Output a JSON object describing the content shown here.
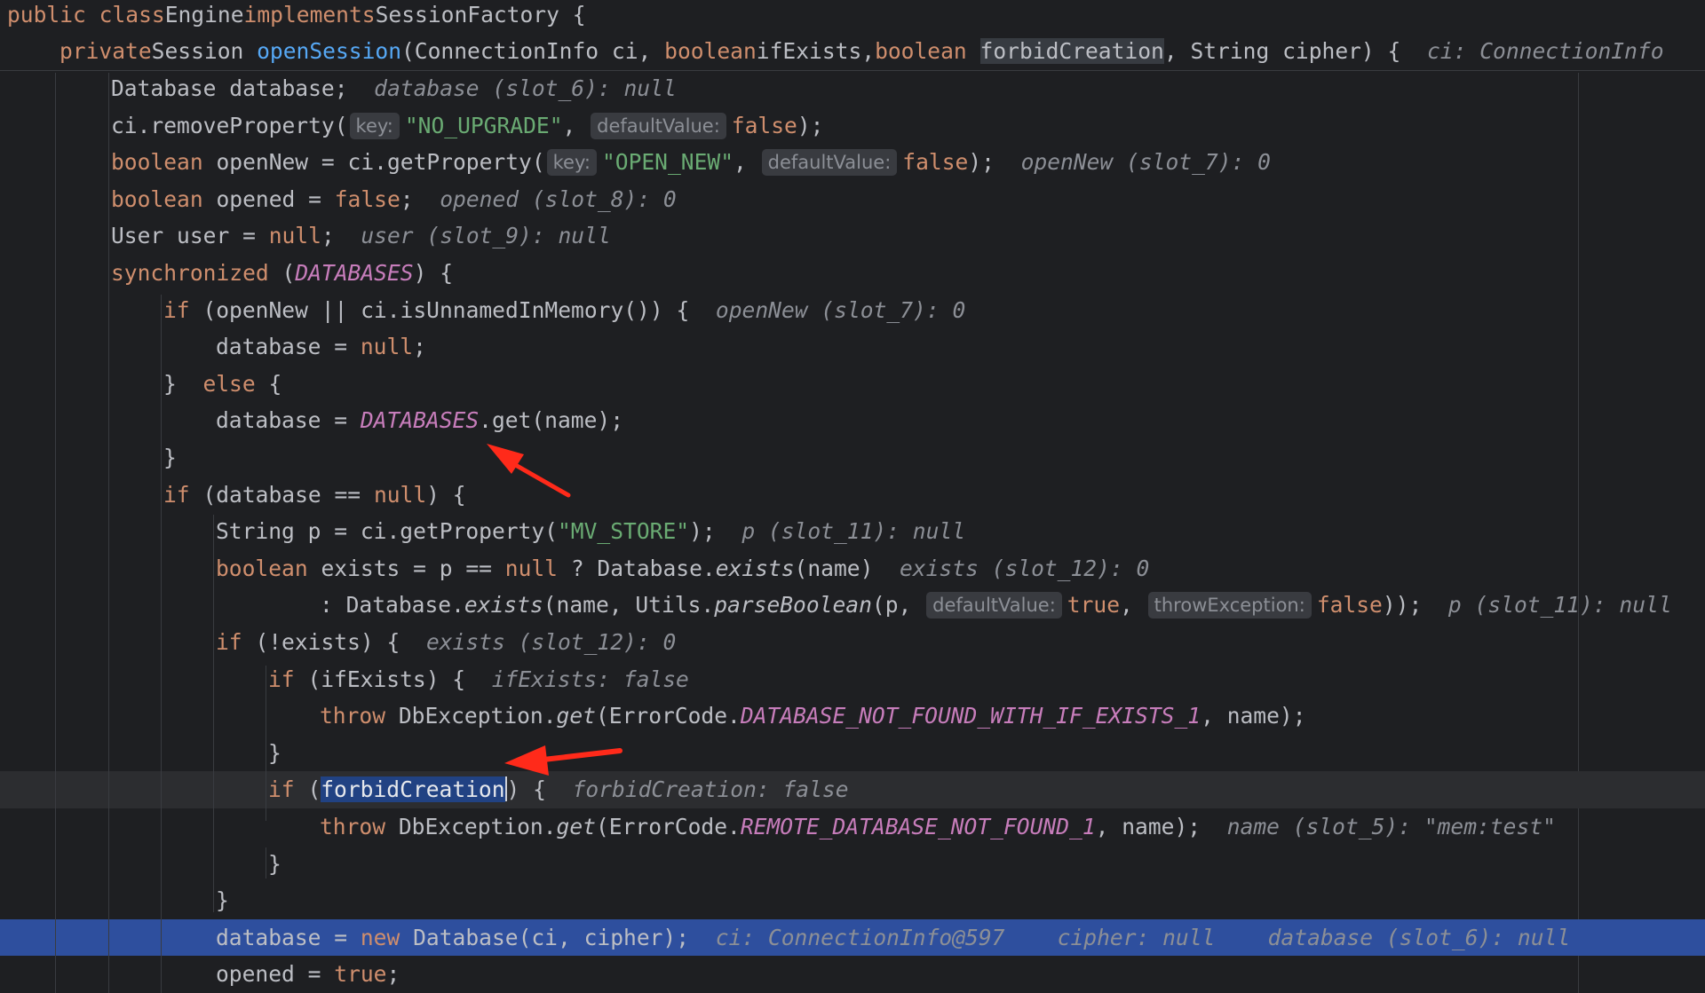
{
  "editor": {
    "lines": [
      {
        "id": "class-decl",
        "tokens": [
          [
            "kw",
            "public class"
          ],
          [
            "",
            "Engine"
          ],
          [
            "kw",
            "implements"
          ],
          [
            "",
            "SessionFactory {"
          ]
        ]
      },
      {
        "id": "method-decl",
        "tokens": [
          [
            "kw",
            "private"
          ],
          [
            "",
            "Session"
          ],
          [
            "fn",
            "openSession"
          ],
          [
            "",
            "(ConnectionInfo ci,"
          ],
          [
            "kw",
            "boolean"
          ],
          [
            "",
            "ifExists,"
          ],
          [
            "kw",
            "boolean"
          ],
          [
            "hl",
            "forbidCreation"
          ],
          [
            "",
            ", String cipher) {"
          ],
          [
            "hint",
            "ci: ConnectionInfo"
          ]
        ]
      },
      {
        "id": "database-decl",
        "tokens": [
          [
            "",
            "Database database;"
          ],
          [
            "hint",
            "database (slot_6): null"
          ]
        ]
      },
      {
        "id": "remove-property",
        "tokens": [
          [
            "",
            "ci.removeProperty("
          ],
          [
            "badge",
            "key:"
          ],
          [
            "st",
            "\"NO_UPGRADE\""
          ],
          [
            "",
            ", "
          ],
          [
            "badge",
            "defaultValue:"
          ],
          [
            "kw",
            "false"
          ],
          [
            "",
            ");"
          ]
        ]
      },
      {
        "id": "open-new",
        "tokens": [
          [
            "kw",
            "boolean"
          ],
          [
            "",
            "openNew = ci.getProperty("
          ],
          [
            "badge",
            "key:"
          ],
          [
            "st",
            "\"OPEN_NEW\""
          ],
          [
            "",
            ", "
          ],
          [
            "badge",
            "defaultValue:"
          ],
          [
            "kw",
            "false"
          ],
          [
            "",
            ");"
          ],
          [
            "hint",
            "openNew (slot_7): 0"
          ]
        ]
      },
      {
        "id": "opened-decl",
        "tokens": [
          [
            "kw",
            "boolean"
          ],
          [
            "",
            "opened = "
          ],
          [
            "kw",
            "false"
          ],
          [
            "",
            ";"
          ],
          [
            "hint",
            "opened (slot_8): 0"
          ]
        ]
      },
      {
        "id": "user-decl",
        "tokens": [
          [
            "",
            "User user = "
          ],
          [
            "kw",
            "null"
          ],
          [
            "",
            ";"
          ],
          [
            "hint",
            "user (slot_9): null"
          ]
        ]
      },
      {
        "id": "synchronized",
        "tokens": [
          [
            "kw",
            "synchronized"
          ],
          [
            "",
            "("
          ],
          [
            "cn",
            "DATABASES"
          ],
          [
            "",
            ") {"
          ]
        ]
      },
      {
        "id": "if-opennew",
        "tokens": [
          [
            "kw",
            "if"
          ],
          [
            "",
            "(openNew || ci.isUnnamedInMemory()) {"
          ],
          [
            "hint",
            "openNew (slot_7): 0"
          ]
        ]
      },
      {
        "id": "database-null",
        "tokens": [
          [
            "",
            "database = "
          ],
          [
            "kw",
            "null"
          ],
          [
            "",
            ";"
          ]
        ]
      },
      {
        "id": "else",
        "tokens": [
          [
            "",
            "} "
          ],
          [
            "kw",
            "else"
          ],
          [
            "",
            "{"
          ]
        ]
      },
      {
        "id": "database-get",
        "tokens": [
          [
            "",
            "database = "
          ],
          [
            "cn",
            "DATABASES"
          ],
          [
            "",
            ".get(name);"
          ]
        ]
      },
      {
        "id": "close-brace-1",
        "tokens": [
          [
            "",
            "}"
          ]
        ]
      },
      {
        "id": "if-database-null",
        "tokens": [
          [
            "kw",
            "if"
          ],
          [
            "",
            "(database == "
          ],
          [
            "kw",
            "null"
          ],
          [
            "",
            ") {"
          ]
        ]
      },
      {
        "id": "mv-store",
        "tokens": [
          [
            "",
            "String p = ci.getProperty("
          ],
          [
            "st",
            "\"MV_STORE\""
          ],
          [
            "",
            ");"
          ],
          [
            "hint",
            "p (slot_11): null"
          ]
        ]
      },
      {
        "id": "exists-decl",
        "tokens": [
          [
            "kw",
            "boolean"
          ],
          [
            "",
            "exists = p == "
          ],
          [
            "kw",
            "null"
          ],
          [
            "",
            "? Database."
          ],
          [
            "it",
            "exists"
          ],
          [
            "",
            "(name)"
          ],
          [
            "hint",
            "exists (slot_12): 0"
          ]
        ]
      },
      {
        "id": "exists-cont",
        "tokens": [
          [
            "",
            ": Database."
          ],
          [
            "it",
            "exists"
          ],
          [
            "",
            "(name, Utils."
          ],
          [
            "it",
            "parseBoolean"
          ],
          [
            "",
            "(p, "
          ],
          [
            "badge",
            "defaultValue:"
          ],
          [
            "kw",
            "true"
          ],
          [
            "",
            ", "
          ],
          [
            "badge",
            "throwException:"
          ],
          [
            "kw",
            "false"
          ],
          [
            "",
            "));"
          ],
          [
            "hint",
            "p (slot_11): null"
          ]
        ]
      },
      {
        "id": "if-not-exists",
        "tokens": [
          [
            "kw",
            "if"
          ],
          [
            "",
            "(!exists) {"
          ],
          [
            "hint",
            "exists (slot_12): 0"
          ]
        ]
      },
      {
        "id": "if-ifexists",
        "tokens": [
          [
            "kw",
            "if"
          ],
          [
            "",
            "(ifExists) {"
          ],
          [
            "hint",
            "ifExists: false"
          ]
        ]
      },
      {
        "id": "throw-1",
        "tokens": [
          [
            "kw",
            "throw"
          ],
          [
            "",
            "DbException."
          ],
          [
            "it",
            "get"
          ],
          [
            "",
            "(ErrorCode."
          ],
          [
            "cn",
            "DATABASE_NOT_FOUND_WITH_IF_EXISTS_1"
          ],
          [
            "",
            ", name);"
          ]
        ]
      },
      {
        "id": "close-brace-2",
        "tokens": [
          [
            "",
            "}"
          ]
        ]
      },
      {
        "id": "if-forbid",
        "tokens": [
          [
            "kw",
            "if"
          ],
          [
            "",
            "("
          ],
          [
            "sel",
            "forbidCreation"
          ],
          [
            "caret",
            ""
          ],
          [
            "",
            ") {"
          ],
          [
            "hint",
            "forbidCreation: false"
          ]
        ]
      },
      {
        "id": "throw-2",
        "tokens": [
          [
            "kw",
            "throw"
          ],
          [
            "",
            "DbException."
          ],
          [
            "it",
            "get"
          ],
          [
            "",
            "(ErrorCode."
          ],
          [
            "cn",
            "REMOTE_DATABASE_NOT_FOUND_1"
          ],
          [
            "",
            ", name);"
          ],
          [
            "hint",
            "name (slot_5): \"mem:test\""
          ]
        ]
      },
      {
        "id": "close-brace-3",
        "tokens": [
          [
            "",
            "}"
          ]
        ]
      },
      {
        "id": "close-brace-4",
        "tokens": [
          [
            "",
            "}"
          ]
        ]
      },
      {
        "id": "new-database",
        "tokens": [
          [
            "",
            "database = "
          ],
          [
            "kw",
            "new"
          ],
          [
            "",
            "Database(ci, cipher);"
          ],
          [
            "hint",
            "ci: ConnectionInfo@597"
          ],
          [
            "hint",
            "cipher: null"
          ],
          [
            "hint",
            "database (slot_6): null"
          ]
        ]
      },
      {
        "id": "opened-true",
        "tokens": [
          [
            "",
            "opened = "
          ],
          [
            "kw",
            "true"
          ],
          [
            "",
            ";"
          ]
        ]
      }
    ]
  },
  "colors": {
    "background": "#1e1f22",
    "keyword": "#cf8e6d",
    "method": "#56a8f5",
    "string": "#6aab73",
    "constant": "#c77dbb",
    "inline_hint": "#8c8f96",
    "execution_line": "#2e4f9e",
    "annotation_arrow": "#ff2a1a"
  }
}
